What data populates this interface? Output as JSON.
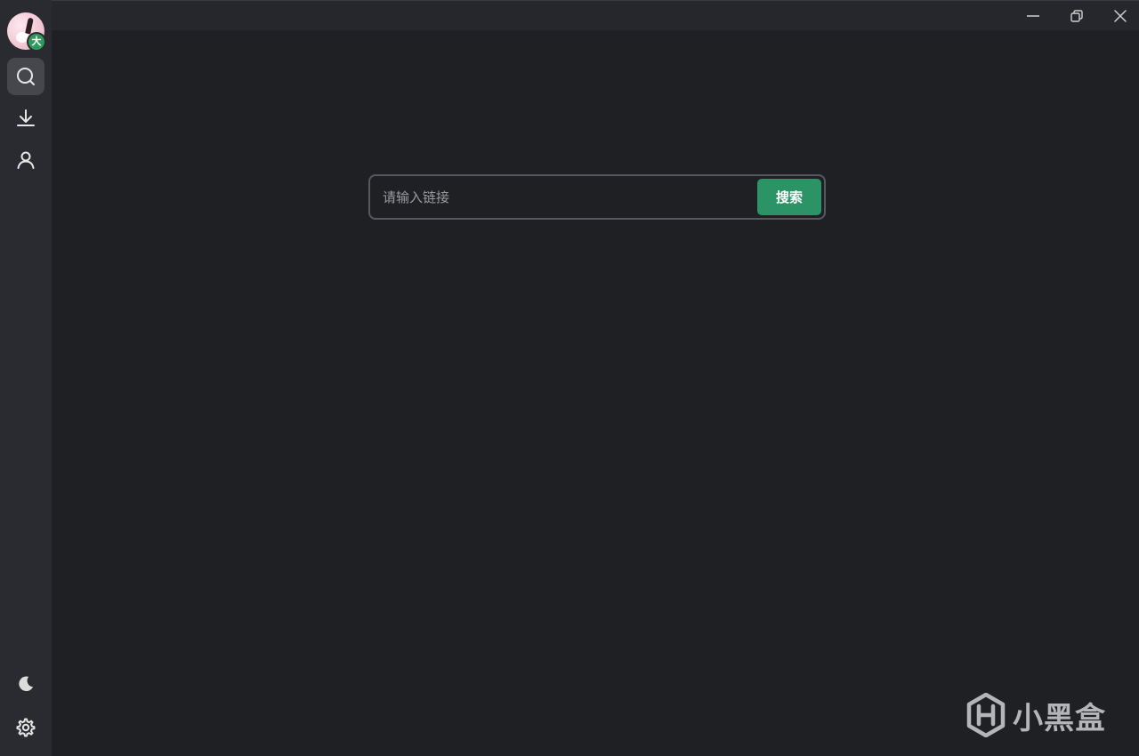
{
  "sidebar": {
    "avatar_badge": "大",
    "items": [
      {
        "icon": "search-icon",
        "active": true
      },
      {
        "icon": "download-icon",
        "active": false
      },
      {
        "icon": "user-icon",
        "active": false
      }
    ],
    "bottom_items": [
      {
        "icon": "moon-icon"
      },
      {
        "icon": "gear-icon"
      }
    ]
  },
  "titlebar": {
    "buttons": [
      "minimize-icon",
      "restore-icon",
      "close-icon"
    ]
  },
  "search": {
    "placeholder": "请输入链接",
    "value": "",
    "button_label": "搜索"
  },
  "watermark": {
    "text": "小黑盒"
  },
  "colors": {
    "background": "#1f2024",
    "sidebar": "#2a2b30",
    "accent": "#2b9365",
    "badge": "#2b9a5c"
  }
}
